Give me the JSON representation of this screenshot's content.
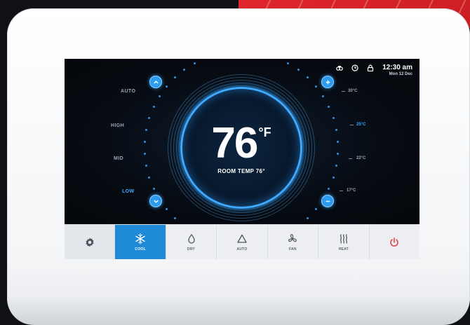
{
  "status": {
    "time": "12:30 am",
    "date": "Mon 12 Dec",
    "icons": [
      "fan-status-icon",
      "clock-icon",
      "lock-icon"
    ]
  },
  "thermostat": {
    "temperature": "76",
    "unit": "°F",
    "room_temp": "ROOM TEMP 76°"
  },
  "fan_speed": {
    "levels": [
      "AUTO",
      "HIGH",
      "MID",
      "LOW"
    ],
    "selected": "LOW"
  },
  "temp_scale": {
    "labels": [
      "30°C",
      "25°C",
      "22°C",
      "17°C"
    ],
    "selected": "25°C"
  },
  "modes": [
    {
      "label": "",
      "icon": "gear-icon"
    },
    {
      "label": "COOL",
      "icon": "snowflake-icon"
    },
    {
      "label": "DRY",
      "icon": "droplet-icon"
    },
    {
      "label": "AUTO",
      "icon": "triangle-icon"
    },
    {
      "label": "FAN",
      "icon": "fan-icon"
    },
    {
      "label": "HEAT",
      "icon": "heat-waves-icon"
    },
    {
      "label": "",
      "icon": "power-icon"
    }
  ],
  "colors": {
    "accent": "#2d9cf0",
    "active_mode": "#1f8ad8",
    "power": "#e5484d",
    "brand_red": "#e1262c"
  }
}
